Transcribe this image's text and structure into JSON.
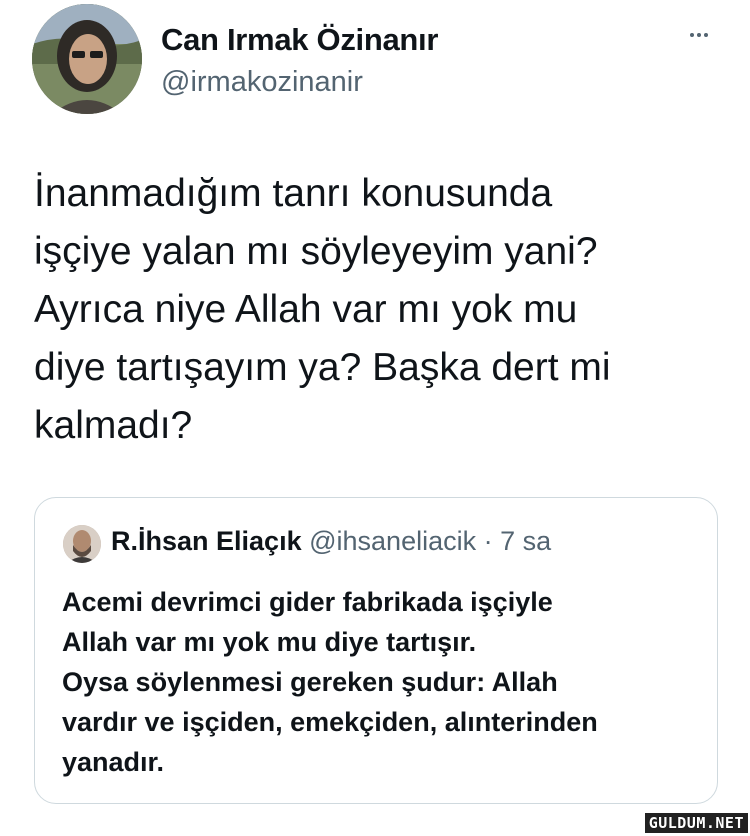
{
  "tweet": {
    "author_name": "Can Irmak Özinanır",
    "author_handle": "@irmakozinanir",
    "more_icon": "more-horizontal-icon",
    "text": "İnanmadığım tanrı konusunda\nişçiye yalan mı söyleyeyim yani?\nAyrıca niye Allah var mı yok mu\ndiye tartışayım ya? Başka dert mi\nkalmadı?"
  },
  "quote": {
    "author_name": "R.İhsan Eliaçık",
    "author_handle": "@ihsaneliacik",
    "separator": "·",
    "time": "7 sa",
    "text": "Acemi devrimci gider fabrikada işçiyle\nAllah var mı yok mu diye tartışır.\nOysa söylenmesi gereken şudur: Allah\nvardır ve işçiden, emekçiden, alınterinden\nyanadır."
  },
  "watermark": "GULDUM.NET",
  "colors": {
    "text_primary": "#0f1419",
    "text_secondary": "#536471",
    "border": "#cfd9de",
    "background": "#ffffff"
  }
}
